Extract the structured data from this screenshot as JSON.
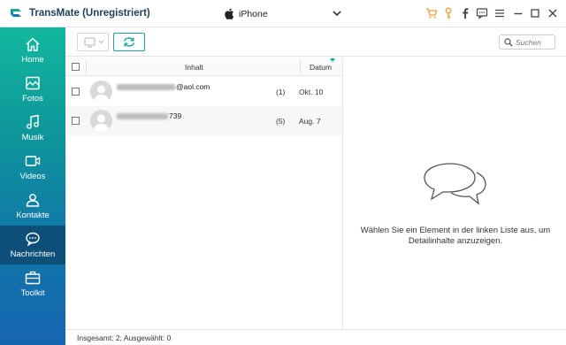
{
  "app": {
    "title": "TransMate (Unregistriert)"
  },
  "device": {
    "name": "iPhone"
  },
  "titlebar_icons": [
    "cart-icon",
    "key-icon",
    "facebook-icon",
    "feedback-icon",
    "menu-icon",
    "minimize-icon",
    "maximize-icon",
    "close-icon"
  ],
  "colors": {
    "accent": "#1aa5a0",
    "sidebar_top": "#13b79f",
    "sidebar_bottom": "#1665b0",
    "active_item": "#0d4f78",
    "titlebar_icon": "#f0a030"
  },
  "sidebar": {
    "items": [
      {
        "label": "Home",
        "icon": "home-icon"
      },
      {
        "label": "Fotos",
        "icon": "photos-icon"
      },
      {
        "label": "Musik",
        "icon": "music-icon"
      },
      {
        "label": "Videos",
        "icon": "video-icon"
      },
      {
        "label": "Kontakte",
        "icon": "contacts-icon"
      },
      {
        "label": "Nachrichten",
        "icon": "messages-icon",
        "active": true
      },
      {
        "label": "Toolkit",
        "icon": "toolkit-icon"
      }
    ]
  },
  "toolbar": {
    "search_placeholder": "Suchen"
  },
  "list": {
    "columns": {
      "content": "Inhalt",
      "date": "Datum"
    },
    "rows": [
      {
        "sender_visible": "@aol.com",
        "count": "(1)",
        "date": "Okt. 10"
      },
      {
        "sender_visible": "739",
        "count": "(5)",
        "date": "Aug. 7"
      }
    ]
  },
  "detail": {
    "message": "Wählen Sie ein Element in der linken Liste aus, um Detailinhalte anzuzeigen."
  },
  "status": {
    "text": "Insgesamt: 2; Ausgewählt: 0"
  }
}
